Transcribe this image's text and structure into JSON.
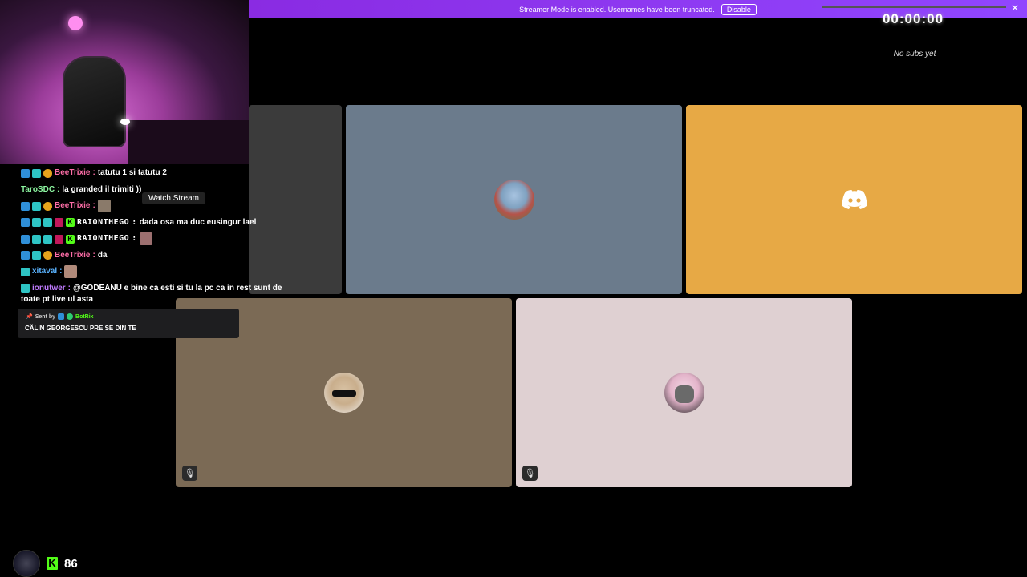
{
  "banner": {
    "text": "Streamer Mode is enabled. Usernames have been truncated.",
    "disable_label": "Disable",
    "close_glyph": "✕"
  },
  "timer": {
    "value": "00:00:00"
  },
  "subs": {
    "text": "No subs yet"
  },
  "tooltip": {
    "text": "Watch Stream"
  },
  "chat": [
    {
      "user": "BeeTrixie",
      "sep": ":",
      "text": "tatutu 1 si tatutu 2"
    },
    {
      "user": "TaroSDC",
      "sep": ":",
      "text": "la granded il trimiti ))"
    },
    {
      "user": "BeeTrixie",
      "sep": ":",
      "text": ""
    },
    {
      "user": "RAIONTHEGO",
      "sep": ":",
      "text": "dada osa ma duc eusingur lael"
    },
    {
      "user": "RAIONTHEGO",
      "sep": ":",
      "text": ""
    },
    {
      "user": "BeeTrixie",
      "sep": ":",
      "text": "da"
    },
    {
      "user": "xitaval",
      "sep": ":",
      "text": ""
    },
    {
      "user": "ionutwer",
      "sep": ":",
      "text": "@GODEANU e bine ca esti si tu la pc ca in rest sunt de",
      "text2": "toate pt live ul asta"
    }
  ],
  "sent": {
    "prefix": "Sent by",
    "bot": "BotRix",
    "body": "CĂLIN GEORGESCU PRE SE DIN TE"
  },
  "footer": {
    "kick_letter": "K",
    "viewer_count": "86"
  },
  "icons": {
    "mute": "mic-off-icon",
    "discord": "discord-icon"
  },
  "colors": {
    "banner": "#9146ff",
    "kick": "#53fc18",
    "tile_orange": "#e7a945",
    "tile_gray": "#6b7b8c",
    "tile_brown": "#7b6a55",
    "tile_pink": "#dfd0d2"
  }
}
